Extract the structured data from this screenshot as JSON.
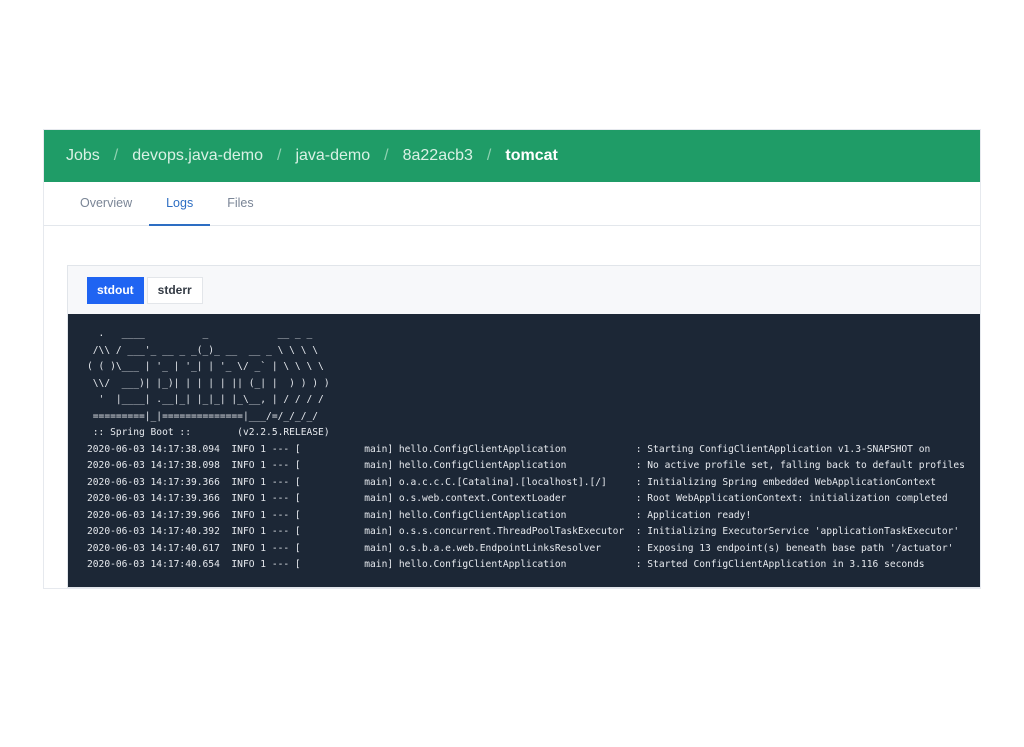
{
  "breadcrumb": {
    "items": [
      "Jobs",
      "devops.java-demo",
      "java-demo",
      "8a22acb3",
      "tomcat"
    ],
    "separator": "/"
  },
  "tabs": [
    {
      "label": "Overview",
      "active": false
    },
    {
      "label": "Logs",
      "active": true
    },
    {
      "label": "Files",
      "active": false
    }
  ],
  "streams": {
    "stdout": "stdout",
    "stderr": "stderr",
    "selected": "stdout"
  },
  "console": {
    "lines": [
      "  .   ____          _            __ _ _",
      " /\\\\ / ___'_ __ _ _(_)_ __  __ _ \\ \\ \\ \\",
      "( ( )\\___ | '_ | '_| | '_ \\/ _` | \\ \\ \\ \\",
      " \\\\/  ___)| |_)| | | | | || (_| |  ) ) ) )",
      "  '  |____| .__|_| |_|_| |_\\__, | / / / /",
      " =========|_|==============|___/=/_/_/_/",
      " :: Spring Boot ::        (v2.2.5.RELEASE)",
      "2020-06-03 14:17:38.094  INFO 1 --- [           main] hello.ConfigClientApplication            : Starting ConfigClientApplication v1.3-SNAPSHOT on",
      "2020-06-03 14:17:38.098  INFO 1 --- [           main] hello.ConfigClientApplication            : No active profile set, falling back to default profiles",
      "2020-06-03 14:17:39.366  INFO 1 --- [           main] o.a.c.c.C.[Catalina].[localhost].[/]     : Initializing Spring embedded WebApplicationContext",
      "2020-06-03 14:17:39.366  INFO 1 --- [           main] o.s.web.context.ContextLoader            : Root WebApplicationContext: initialization completed",
      "2020-06-03 14:17:39.966  INFO 1 --- [           main] hello.ConfigClientApplication            : Application ready!",
      "2020-06-03 14:17:40.392  INFO 1 --- [           main] o.s.s.concurrent.ThreadPoolTaskExecutor  : Initializing ExecutorService 'applicationTaskExecutor'",
      "2020-06-03 14:17:40.617  INFO 1 --- [           main] o.s.b.a.e.web.EndpointLinksResolver      : Exposing 13 endpoint(s) beneath base path '/actuator'",
      "2020-06-03 14:17:40.654  INFO 1 --- [           main] hello.ConfigClientApplication            : Started ConfigClientApplication in 3.116 seconds"
    ]
  },
  "colors": {
    "header": "#1f9c67",
    "active_tab": "#2d6ec3",
    "active_stream": "#1f64f2",
    "console_bg": "#1c2736"
  }
}
